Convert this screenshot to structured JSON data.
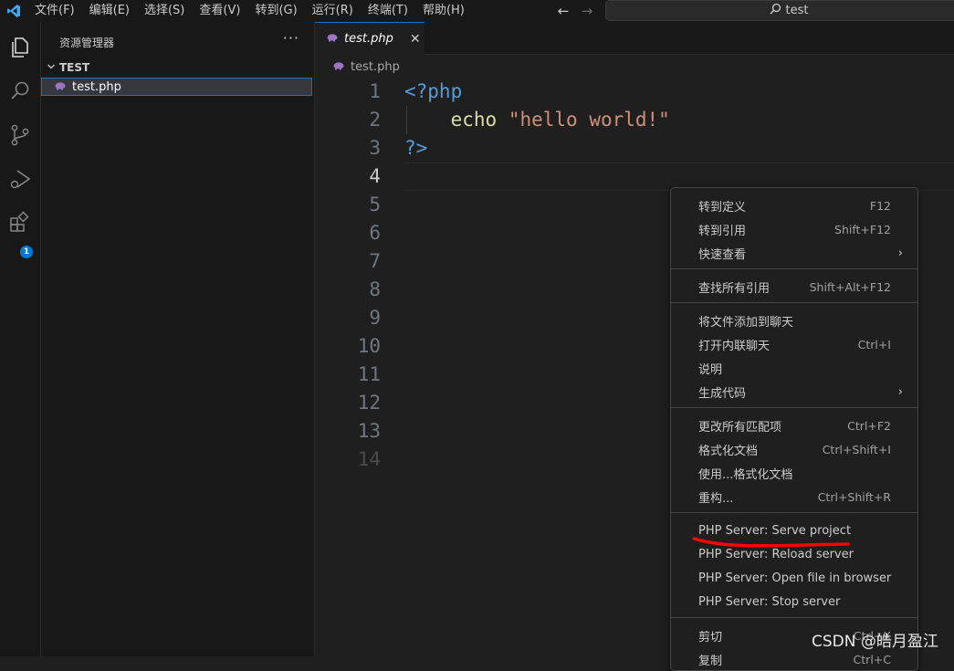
{
  "menubar": {
    "items": [
      "文件(F)",
      "编辑(E)",
      "选择(S)",
      "查看(V)",
      "转到(G)",
      "运行(R)",
      "终端(T)",
      "帮助(H)"
    ]
  },
  "search": {
    "text": "test"
  },
  "activity": {
    "extensions_badge": "1"
  },
  "sidebar": {
    "title": "资源管理器",
    "more": "···",
    "folder": "TEST",
    "file": "test.php"
  },
  "editor": {
    "tab_label": "test.php",
    "breadcrumb": "test.php",
    "line_numbers": [
      "1",
      "2",
      "3",
      "4",
      "5",
      "6",
      "7",
      "8",
      "9",
      "10",
      "11",
      "12",
      "13",
      "14"
    ],
    "code": {
      "line1": "<?php",
      "line2_kw": "echo",
      "line2_str": "\"hello world!\"",
      "line3": "?>"
    }
  },
  "context_menu": {
    "items": [
      {
        "label": "转到定义",
        "key": "F12"
      },
      {
        "label": "转到引用",
        "key": "Shift+F12"
      },
      {
        "label": "快速查看",
        "submenu": "›"
      },
      {
        "label": "查找所有引用",
        "key": "Shift+Alt+F12"
      },
      {
        "label": "将文件添加到聊天",
        "key": ""
      },
      {
        "label": "打开内联聊天",
        "key": "Ctrl+I"
      },
      {
        "label": "说明",
        "key": ""
      },
      {
        "label": "生成代码",
        "submenu": "›"
      },
      {
        "label": "更改所有匹配项",
        "key": "Ctrl+F2"
      },
      {
        "label": "格式化文档",
        "key": "Ctrl+Shift+I"
      },
      {
        "label": "使用...格式化文档",
        "key": ""
      },
      {
        "label": "重构...",
        "key": "Ctrl+Shift+R"
      },
      {
        "label": "PHP Server: Serve project",
        "key": ""
      },
      {
        "label": "PHP Server: Reload server",
        "key": ""
      },
      {
        "label": "PHP Server: Open file in browser",
        "key": ""
      },
      {
        "label": "PHP Server: Stop server",
        "key": ""
      },
      {
        "label": "剪切",
        "key": "Ctrl+X"
      },
      {
        "label": "复制",
        "key": "Ctrl+C"
      }
    ]
  },
  "watermark": "CSDN @皓月盈江",
  "colors": {
    "accent": "#0078d4",
    "keyword": "#569cd6",
    "function": "#dcdcaa",
    "string": "#ce9178",
    "annotation_red": "#ff0000",
    "php_icon": "#a074c4"
  }
}
